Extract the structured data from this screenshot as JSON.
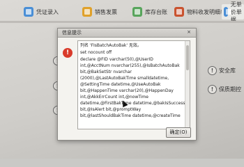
{
  "tabs": [
    {
      "label": "凭证录入",
      "color": "#4a8fd6"
    },
    {
      "label": "销售发票",
      "color": "#e0a12a"
    },
    {
      "label": "库存台账",
      "color": "#58a55c"
    },
    {
      "label": "物料收发明细表",
      "color": "#c9532f"
    },
    {
      "label": "无单价单据",
      "color": "#4a8fd6"
    }
  ],
  "left_warning_icon": "!",
  "right_labels": [
    "安全库",
    "保质期控"
  ],
  "dialog": {
    "title": "信息提示",
    "close_label": "×",
    "error_icon": "!",
    "message_lines": [
      "列名 'FIsBatchAutoBak' 无效。",
      "set nocount off",
      "declare @FID varchar(50),@UserID",
      "int,@AcctNum nvarchar(255),@IsBatchAutoBak",
      "bit,@BakSetStr nvarchar",
      "(2000),@LastAutoBakTime smalldatetime,",
      "@SettingTime datetime,@UseAutoBak",
      "bit,@HappenTime varchar(20),@HappenDay",
      "int,@AkkErrCount int,@nowTime",
      "datetime,@FirstBakTime datetime,@bakIsSuccess",
      "bit,@IsAlert bit,@promptWay",
      "bit,@lastShouldBakTime datetime,@createTime"
    ],
    "ok_label": "确定(O)"
  }
}
